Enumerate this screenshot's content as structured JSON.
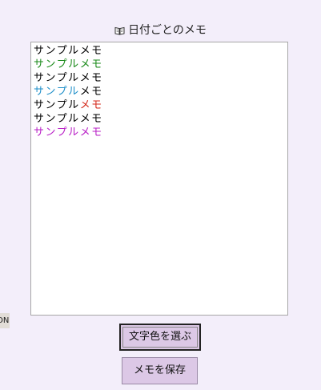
{
  "header": {
    "icon": "book-icon",
    "title": "日付ごとのメモ"
  },
  "memo": {
    "lines": [
      {
        "text": "サンプルメモ",
        "segments": [
          {
            "text": "サンプルメモ",
            "color": "#000000"
          }
        ]
      },
      {
        "text": "サンプルメモ",
        "segments": [
          {
            "text": "サンプルメモ",
            "color": "#1a8a1a"
          }
        ]
      },
      {
        "text": "サンプルメモ",
        "segments": [
          {
            "text": "サンプルメモ",
            "color": "#000000"
          }
        ]
      },
      {
        "text": "サンプルメモ",
        "segments": [
          {
            "text": "サンプル",
            "color": "#1f8fc9"
          },
          {
            "text": "メモ",
            "color": "#000000"
          }
        ]
      },
      {
        "text": "サンプルメモ",
        "segments": [
          {
            "text": "サンプル",
            "color": "#000000"
          },
          {
            "text": "メモ",
            "color": "#d42a1c"
          }
        ]
      },
      {
        "text": "サンプルメモ",
        "segments": [
          {
            "text": "サンプルメモ",
            "color": "#000000"
          }
        ]
      },
      {
        "text": "サンプルメモ",
        "segments": [
          {
            "text": "サンプルメモ",
            "color": "#b81fc6"
          }
        ]
      }
    ]
  },
  "side_tab": {
    "label": "ON"
  },
  "buttons": {
    "choose_color": "文字色を選ぶ",
    "save_memo": "メモを保存"
  },
  "colors": {
    "background": "#f3eefa",
    "button_bg": "#dcc8e6"
  }
}
